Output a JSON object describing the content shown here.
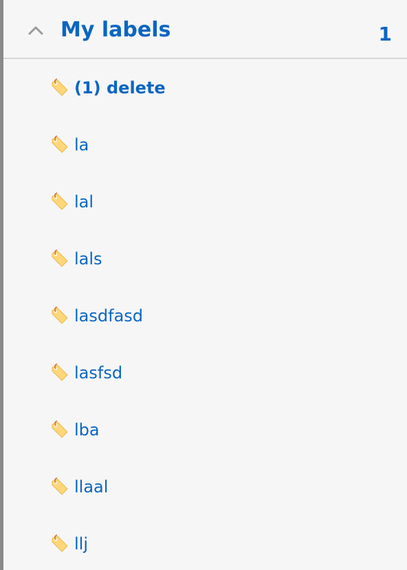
{
  "section": {
    "title": "My labels",
    "count": "1",
    "expanded": true
  },
  "labels": [
    {
      "text": "(1) delete",
      "bold": true
    },
    {
      "text": "la"
    },
    {
      "text": "lal"
    },
    {
      "text": "lals"
    },
    {
      "text": "lasdfasd"
    },
    {
      "text": "lasfsd"
    },
    {
      "text": "lba"
    },
    {
      "text": "llaal"
    },
    {
      "text": "llj"
    }
  ],
  "colors": {
    "accent": "#0a66c2",
    "tag_fill": "#ffd77a",
    "tag_string": "#d2691e",
    "background": "#f6f6f6"
  },
  "icons": {
    "collapse": "chevron-up-icon",
    "label": "tag-icon"
  }
}
